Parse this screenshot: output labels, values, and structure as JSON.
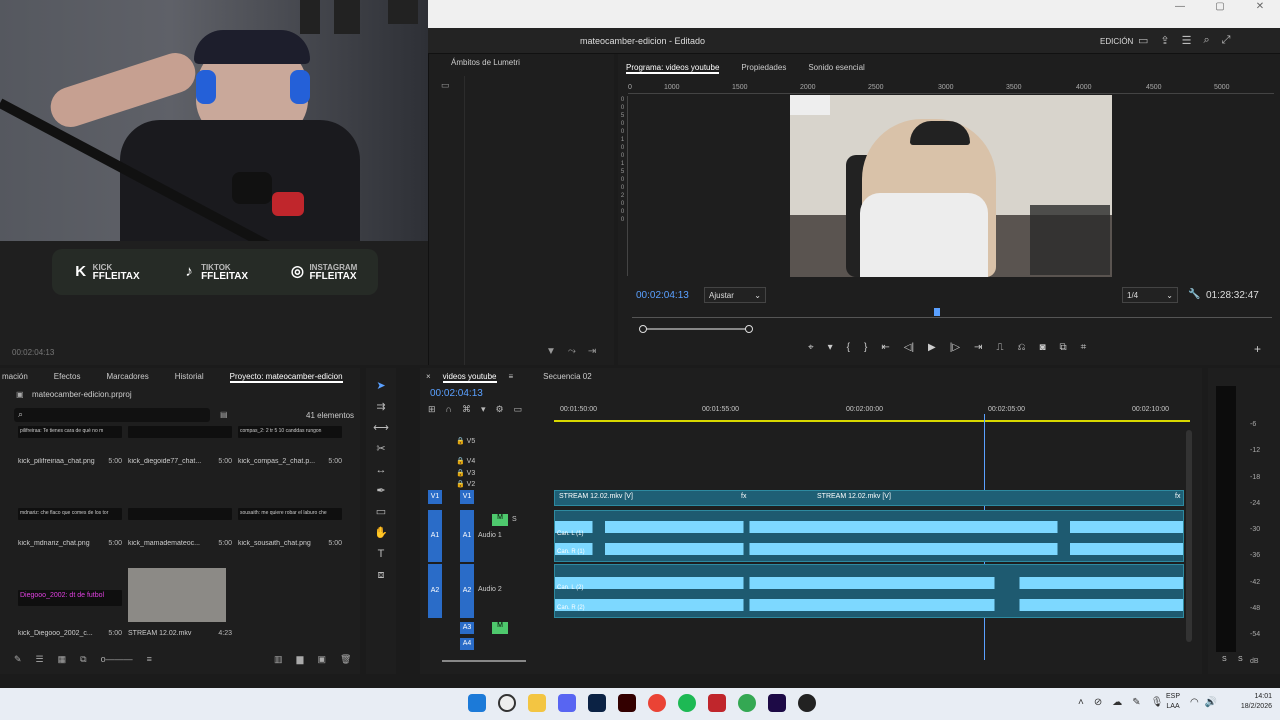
{
  "window": {
    "title": "mateocamber-edicion - Editado",
    "mode": "EDICIÓN"
  },
  "lumetri": {
    "tab": "Ámbitos de Lumetri"
  },
  "socials": [
    {
      "platform": "KICK",
      "handle": "FFLEITAX",
      "icon": "kick-icon"
    },
    {
      "platform": "TIKTOK",
      "handle": "FFLEITAX",
      "icon": "tiktok-icon"
    },
    {
      "platform": "INSTAGRAM",
      "handle": "FFLEITAX",
      "icon": "instagram-icon"
    }
  ],
  "source": {
    "timecode": "00:02:04:13"
  },
  "program": {
    "tabs": [
      "Programa: videos youtube",
      "Propiedades",
      "Sonido esencial"
    ],
    "timecode": "00:02:04:13",
    "fit": "Ajustar",
    "quality": "1/4",
    "duration": "01:28:32:47",
    "ruler": [
      "0",
      "1000",
      "1500",
      "2000",
      "2500",
      "3000",
      "3500",
      "4000",
      "4500",
      "5000"
    ],
    "ruler_v": [
      "0",
      "0",
      "5",
      "0",
      "0",
      "1",
      "0",
      "0",
      "1",
      "5",
      "0",
      "0",
      "2",
      "0",
      "0",
      "0"
    ]
  },
  "project": {
    "tabs": [
      "mación",
      "Efectos",
      "Marcadores",
      "Historial",
      "Proyecto: mateocamber-edicion"
    ],
    "file": "mateocamber-edicion.prproj",
    "count": "41 elementos",
    "items": [
      {
        "thumb": "pilifreiraa: Te tienes cara de qué no m",
        "name": "kick_pilifreiriaa_chat.png",
        "dur": "5:00"
      },
      {
        "thumb": "",
        "name": "kick_diegoide77_chat...",
        "dur": "5:00"
      },
      {
        "thumb": "compas_2: 2 tr 5 10 canddas rungon",
        "name": "kick_compas_2_chat.p...",
        "dur": "5:00"
      },
      {
        "thumb": "mdnariz: che flaco que comes de los tor",
        "name": "kick_mdnariz_chat.png",
        "dur": "5:00"
      },
      {
        "thumb": "",
        "name": "kick_mamademateoc...",
        "dur": "5:00"
      },
      {
        "thumb": "sousaith: me quiere robar el laburo che",
        "name": "kick_sousaith_chat.png",
        "dur": "5:00"
      },
      {
        "thumb": "Diegooo_2002: dt de futbol",
        "name": "kick_Diegooo_2002_c...",
        "dur": "5:00"
      },
      {
        "thumb": "",
        "name": "STREAM 12.02.mkv",
        "dur": "4:23"
      }
    ]
  },
  "timeline": {
    "tabs": [
      "videos youtube",
      "Secuencia 02"
    ],
    "timecode": "00:02:04:13",
    "ruler": [
      "00:01:50:00",
      "00:01:55:00",
      "00:02:00:00",
      "00:02:05:00",
      "00:02:10:00"
    ],
    "tracks_v": [
      "V5",
      "V4",
      "V3",
      "V2",
      "V1"
    ],
    "tracks_a": [
      "A1",
      "A2",
      "A3",
      "A4"
    ],
    "audio1": "Audio 1",
    "audio2": "Audio 2",
    "clip_video": "STREAM 12.02.mkv [V]",
    "chan_l1": "Can. L (1)",
    "chan_r1": "Can. R (1)",
    "chan_l2": "Can. L (2)",
    "chan_r2": "Can. R (2)",
    "fx": "fx",
    "m": "M",
    "s": "S"
  },
  "meter": {
    "scale": [
      "-6",
      "-12",
      "-18",
      "-24",
      "-30",
      "-36",
      "-42",
      "-48",
      "-54",
      "dB"
    ],
    "solo": "S"
  },
  "taskbar": {
    "lang": "ESP",
    "layout": "LAA",
    "time": "14:01",
    "date": "18/2/2026"
  }
}
